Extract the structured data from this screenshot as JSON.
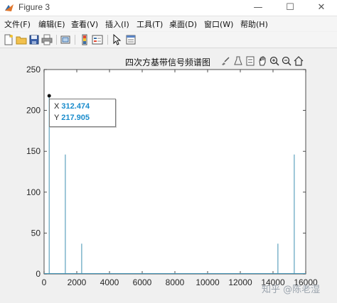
{
  "window": {
    "title": "Figure 3",
    "controls": {
      "minimize": "—",
      "maximize": "☐",
      "close": "✕"
    }
  },
  "menu": [
    {
      "label": "文件(F)"
    },
    {
      "label": "编辑(E)"
    },
    {
      "label": "查看(V)"
    },
    {
      "label": "插入(I)"
    },
    {
      "label": "工具(T)"
    },
    {
      "label": "桌面(D)"
    },
    {
      "label": "窗口(W)"
    },
    {
      "label": "帮助(H)"
    }
  ],
  "toolbar": {
    "icons": [
      "new-figure-icon",
      "open-icon",
      "save-icon",
      "print-icon",
      "link-plot-icon",
      "colorbar-icon",
      "legend-icon",
      "edit-plot-icon",
      "property-inspector-icon"
    ]
  },
  "axes_toolbar": {
    "icons": [
      "brush-icon",
      "data-cursor-icon",
      "link-icon",
      "pan-icon",
      "zoom-in-icon",
      "zoom-out-icon",
      "home-icon"
    ]
  },
  "chart_data": {
    "type": "line",
    "title": "四次方基带信号频谱图",
    "xlabel": "",
    "ylabel": "",
    "xlim": [
      0,
      16000
    ],
    "ylim": [
      0,
      250
    ],
    "x_ticks": [
      "0",
      "2000",
      "4000",
      "6000",
      "8000",
      "10000",
      "12000",
      "14000",
      "16000"
    ],
    "y_ticks": [
      "0",
      "50",
      "100",
      "150",
      "200",
      "250"
    ],
    "grid": false,
    "series": [
      {
        "color": "#3d8fb0",
        "peaks": [
          {
            "x": 312.474,
            "y": 217.905
          },
          {
            "x": 1300,
            "y": 146
          },
          {
            "x": 2300,
            "y": 37
          },
          {
            "x": 14300,
            "y": 37
          },
          {
            "x": 15300,
            "y": 146
          }
        ]
      }
    ],
    "datatip": {
      "x_label": "X",
      "x_value": "312.474",
      "y_label": "Y",
      "y_value": "217.905"
    }
  },
  "watermark": "知乎 @陈老湿"
}
